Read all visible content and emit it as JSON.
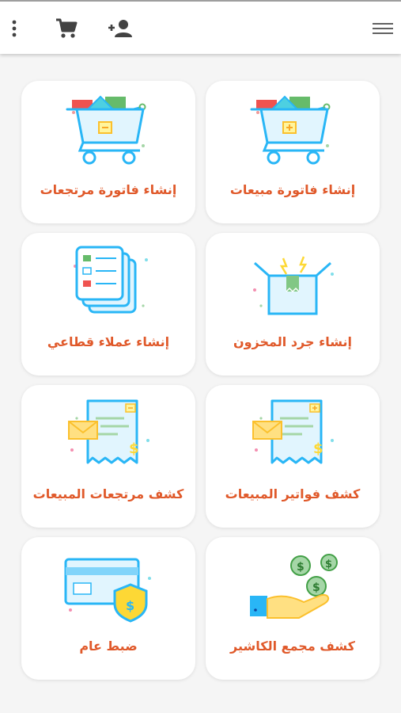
{
  "header": {
    "icons": {
      "menu": "hamburger-menu-icon",
      "add_user": "add-user-icon",
      "cart": "shopping-cart-icon",
      "more": "more-vertical-icon"
    }
  },
  "tiles": [
    {
      "label": "إنشاء فاتورة مبيعات",
      "icon": "cart-plus-illustration"
    },
    {
      "label": "إنشاء فاتورة مرتجعات",
      "icon": "cart-minus-illustration"
    },
    {
      "label": "إنشاء جرد المخزون",
      "icon": "inventory-box-illustration"
    },
    {
      "label": "إنشاء عملاء قطاعي",
      "icon": "customer-list-illustration"
    },
    {
      "label": "كشف فواتير المبيعات",
      "icon": "sales-invoice-illustration"
    },
    {
      "label": "كشف مرتجعات المبيعات",
      "icon": "returns-invoice-illustration"
    },
    {
      "label": "كشف مجمع الكاشير",
      "icon": "cashier-coins-illustration"
    },
    {
      "label": "ضبط عام",
      "icon": "general-settings-card-shield-illustration"
    }
  ],
  "colors": {
    "accent_text": "#e0592a",
    "illus_blue": "#29b6f6",
    "illus_green": "#66bb6a",
    "illus_yellow": "#fdd835",
    "illus_red": "#ef5350",
    "background": "#f5f5f5"
  }
}
